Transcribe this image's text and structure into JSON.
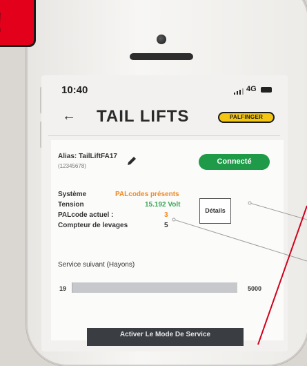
{
  "status_bar": {
    "time": "10:40",
    "network": "4G"
  },
  "header": {
    "back_icon": "arrow-left-icon",
    "title": "TAIL LIFTS",
    "logo_text": "PALFINGER"
  },
  "device": {
    "alias": "Alias: TailLiftFA17",
    "serial": "(12345678)",
    "edit_icon": "pencil-icon",
    "connection_status": "Connecté"
  },
  "info_rows": [
    {
      "label": "Système",
      "value": "PALcodes présents",
      "color": "#f08a24"
    },
    {
      "label": "Tension",
      "value": "15.192 Volt",
      "color": "#3aa655"
    },
    {
      "label": "PALcode actuel :",
      "value": "3",
      "color": "#f08a24"
    },
    {
      "label": "Compteur de levages",
      "value": "5",
      "color": "#333333"
    }
  ],
  "details_button": "Détails",
  "service": {
    "label": "Service suivant (Hayons)",
    "current": "19",
    "max": "5000",
    "progress_fraction": 0.0038
  },
  "service_mode_button": "Activer Le Mode De Service",
  "annotation": {
    "mark": "!",
    "color": "#e3001b"
  }
}
